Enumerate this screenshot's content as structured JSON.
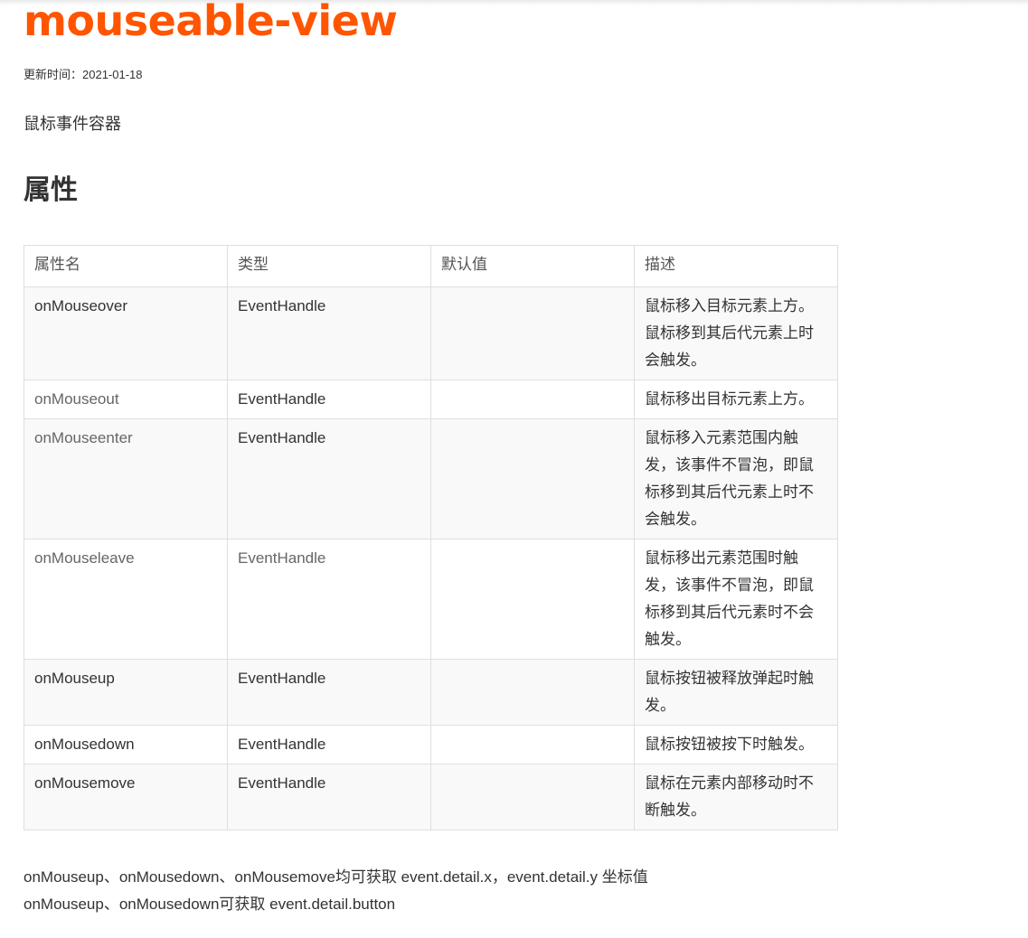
{
  "page": {
    "title": "mouseable-view",
    "update_label": "更新时间：",
    "update_date": "2021-01-18",
    "description": "鼠标事件容器",
    "section_heading": "属性"
  },
  "table": {
    "headers": [
      "属性名",
      "类型",
      "默认值",
      "描述"
    ],
    "rows": [
      {
        "name": "onMouseover",
        "type": "EventHandle",
        "default": "",
        "desc": "鼠标移入目标元素上方。鼠标移到其后代元素上时会触发。"
      },
      {
        "name": "onMouseout",
        "type": "EventHandle",
        "default": "",
        "desc": "鼠标移出目标元素上方。"
      },
      {
        "name": "onMouseenter",
        "type": "EventHandle",
        "default": "",
        "desc": "鼠标移入元素范围内触发，该事件不冒泡，即鼠标移到其后代元素上时不会触发。"
      },
      {
        "name": "onMouseleave",
        "type": "EventHandle",
        "default": "",
        "desc": "鼠标移出元素范围时触发，该事件不冒泡，即鼠标移到其后代元素时不会触发。"
      },
      {
        "name": "onMouseup",
        "type": "EventHandle",
        "default": "",
        "desc": "鼠标按钮被释放弹起时触发。"
      },
      {
        "name": "onMousedown",
        "type": "EventHandle",
        "default": "",
        "desc": "鼠标按钮被按下时触发。"
      },
      {
        "name": "onMousemove",
        "type": "EventHandle",
        "default": "",
        "desc": "鼠标在元素内部移动时不断触发。"
      }
    ]
  },
  "notes": [
    "onMouseup、onMousedown、onMousemove均可获取 event.detail.x，event.detail.y 坐标值",
    "onMouseup、onMousedown可获取 event.detail.button"
  ]
}
